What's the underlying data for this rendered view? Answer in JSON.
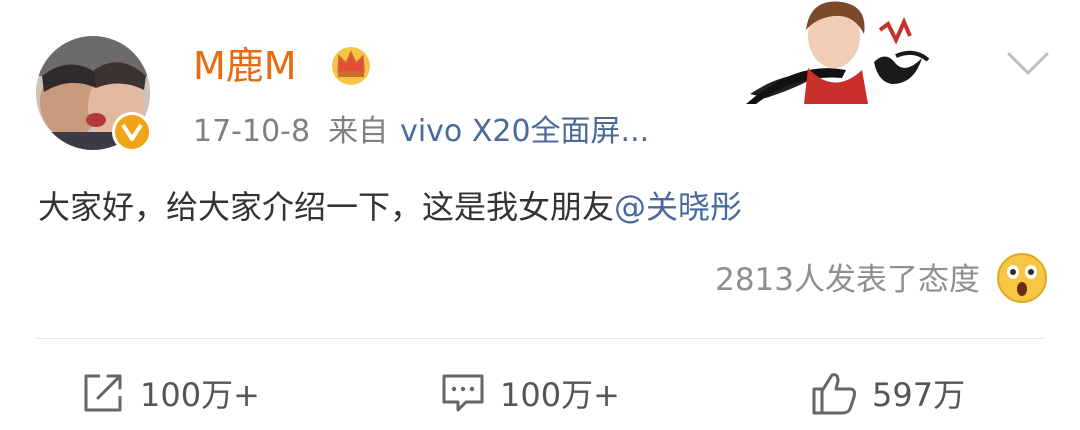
{
  "post": {
    "username": "M鹿M",
    "date": "17-10-8",
    "from_label": "来自",
    "device": "vivo X20全面屏...",
    "text": "大家好，给大家介绍一下，这是我女朋友",
    "mention": "@关晓彤",
    "reactions_text": "2813人发表了态度",
    "actions": {
      "repost_count": "100万+",
      "comment_count": "100万+",
      "like_count": "597万"
    }
  },
  "icons": {
    "verified": "verified-v-icon",
    "crown": "crown-icon",
    "chevron": "chevron-down-icon",
    "emoji": "wow-emoji-icon",
    "repost": "repost-icon",
    "comment": "comment-icon",
    "like": "thumbs-up-icon"
  },
  "colors": {
    "username": "#e86b0f",
    "link": "#4a6a9c",
    "badge": "#f0a416",
    "muted": "#808080"
  }
}
